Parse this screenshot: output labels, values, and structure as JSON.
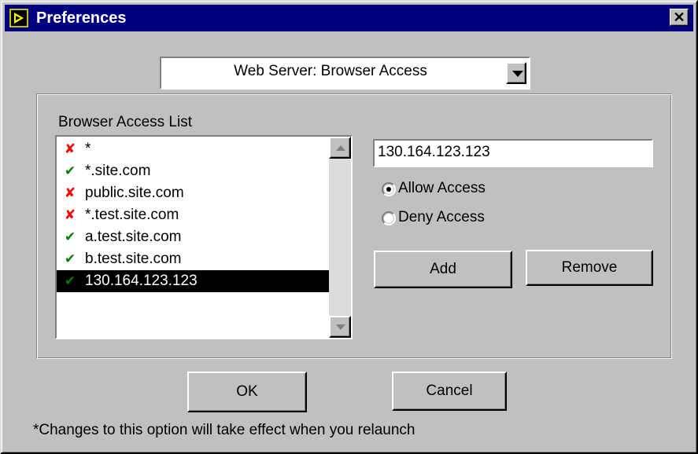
{
  "window": {
    "title": "Preferences",
    "close_icon": "close-icon",
    "app_icon": "labview-icon"
  },
  "category_dropdown": {
    "selected": "Web Server: Browser Access",
    "icon": "chevron-down-icon"
  },
  "browser_access": {
    "list_label": "Browser Access List",
    "items": [
      {
        "text": "*",
        "access": "deny"
      },
      {
        "text": "*.site.com",
        "access": "allow"
      },
      {
        "text": "public.site.com",
        "access": "deny"
      },
      {
        "text": "*.test.site.com",
        "access": "deny"
      },
      {
        "text": "a.test.site.com",
        "access": "allow"
      },
      {
        "text": "b.test.site.com",
        "access": "allow"
      },
      {
        "text": "130.164.123.123",
        "access": "allow",
        "selected": true
      }
    ],
    "deny_glyph": "✘",
    "allow_glyph": "✔",
    "address_value": "130.164.123.123",
    "allow_label": "Allow Access",
    "deny_label": "Deny Access",
    "selected_access": "allow",
    "add_label": "Add",
    "remove_label": "Remove"
  },
  "buttons": {
    "ok_label": "OK",
    "cancel_label": "Cancel"
  },
  "footnote": "*Changes to this option will take effect when you relaunch",
  "colors": {
    "titlebar": "#000080",
    "deny": "#ff0000",
    "allow": "#008000",
    "face": "#c0c0c0"
  }
}
